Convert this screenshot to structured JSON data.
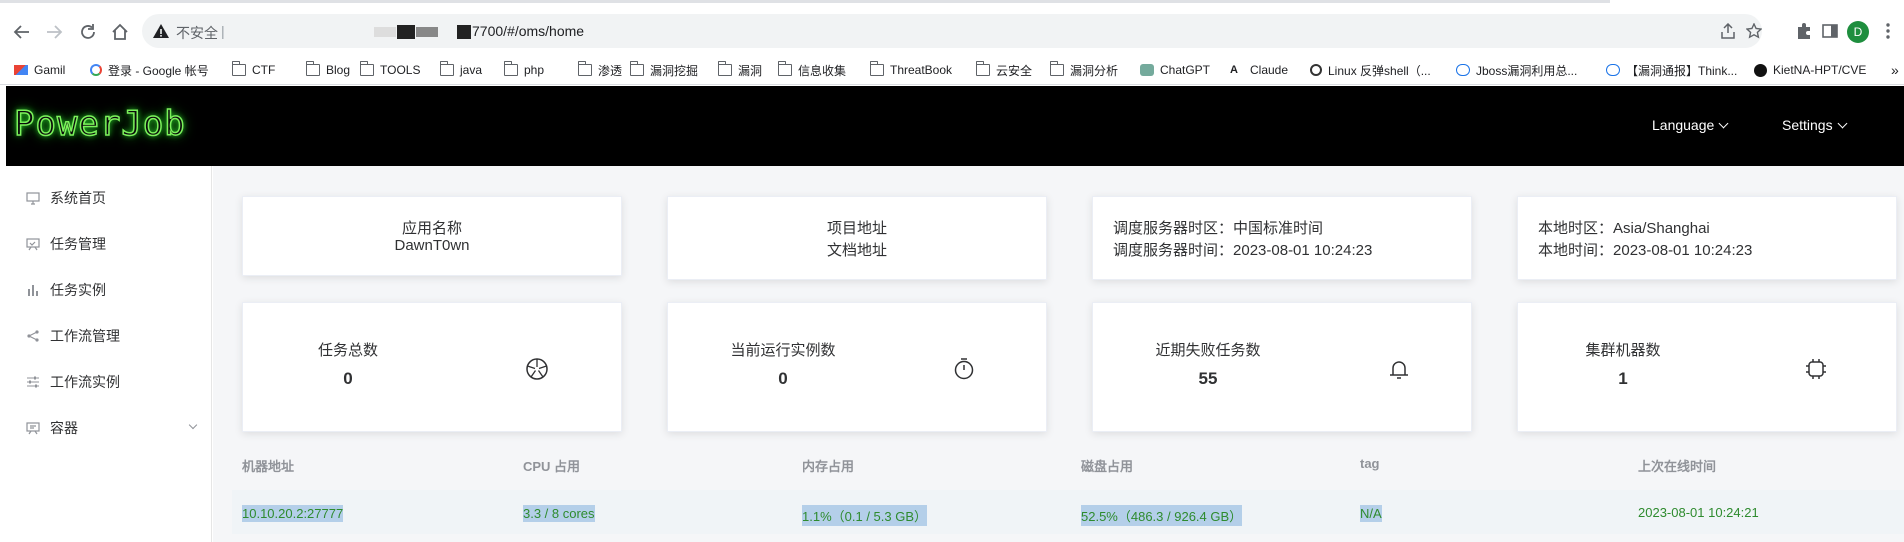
{
  "browser": {
    "insecure_label": "不安全",
    "separator": "|",
    "url_suffix": "7700/#/oms/home",
    "profile_initial": "D"
  },
  "bookmarks": [
    {
      "label": "Gamil",
      "icon": "gmail-icon"
    },
    {
      "label": "登录 - Google 帐号",
      "icon": "google-icon"
    },
    {
      "label": "CTF",
      "icon": "folder-icon"
    },
    {
      "label": "Blog",
      "icon": "folder-icon"
    },
    {
      "label": "TOOLS",
      "icon": "folder-icon"
    },
    {
      "label": "java",
      "icon": "folder-icon"
    },
    {
      "label": "php",
      "icon": "folder-icon"
    },
    {
      "label": "渗透",
      "icon": "folder-icon"
    },
    {
      "label": "漏洞挖掘",
      "icon": "folder-icon"
    },
    {
      "label": "漏洞",
      "icon": "folder-icon"
    },
    {
      "label": "信息收集",
      "icon": "folder-icon"
    },
    {
      "label": "ThreatBook",
      "icon": "folder-icon"
    },
    {
      "label": "云安全",
      "icon": "folder-icon"
    },
    {
      "label": "漏洞分析",
      "icon": "folder-icon"
    },
    {
      "label": "ChatGPT",
      "icon": "chatgpt-icon"
    },
    {
      "label": "Claude",
      "icon": "claude-icon"
    },
    {
      "label": "Linux 反弹shell（...",
      "icon": "globe-icon"
    },
    {
      "label": "Jboss漏洞利用总...",
      "icon": "cloud-icon"
    },
    {
      "label": "【漏洞通报】Think...",
      "icon": "cloud-icon"
    },
    {
      "label": "KietNA-HPT/CVE",
      "icon": "github-icon"
    },
    {
      "label": "»",
      "icon": "more-icon"
    }
  ],
  "header": {
    "logo": "PowerJob",
    "language": "Language",
    "settings": "Settings"
  },
  "sidebar": {
    "items": [
      {
        "label": "系统首页",
        "icon": "monitor-icon"
      },
      {
        "label": "任务管理",
        "icon": "task-board-icon"
      },
      {
        "label": "任务实例",
        "icon": "bar-chart-icon"
      },
      {
        "label": "工作流管理",
        "icon": "share-icon"
      },
      {
        "label": "工作流实例",
        "icon": "sliders-icon"
      },
      {
        "label": "容器",
        "icon": "container-icon"
      }
    ]
  },
  "info_cards": {
    "app": {
      "title": "应用名称",
      "value": "DawnT0wn"
    },
    "project": {
      "title": "项目地址",
      "value": "文档地址"
    },
    "server": {
      "tz_label": "调度服务器时区：",
      "tz_value": "中国标准时间",
      "time_label": "调度服务器时间：",
      "time_value": "2023-08-01 10:24:23"
    },
    "local": {
      "tz_label": "本地时区：",
      "tz_value": "Asia/Shanghai",
      "time_label": "本地时间：",
      "time_value": "2023-08-01 10:24:23"
    }
  },
  "stats": [
    {
      "label": "任务总数",
      "value": "0",
      "icon": "aperture-icon"
    },
    {
      "label": "当前运行实例数",
      "value": "0",
      "icon": "stopwatch-icon"
    },
    {
      "label": "近期失败任务数",
      "value": "55",
      "icon": "bell-icon"
    },
    {
      "label": "集群机器数",
      "value": "1",
      "icon": "cpu-icon"
    }
  ],
  "table": {
    "headers": [
      "机器地址",
      "CPU 占用",
      "内存占用",
      "磁盘占用",
      "tag",
      "上次在线时间"
    ],
    "rows": [
      [
        "10.10.20.2:27777",
        "3.3 / 8 cores",
        "1.1%（0.1 / 5.3 GB）",
        "52.5%（486.3 / 926.4 GB）",
        "N/A",
        "2023-08-01 10:24:21"
      ]
    ]
  }
}
